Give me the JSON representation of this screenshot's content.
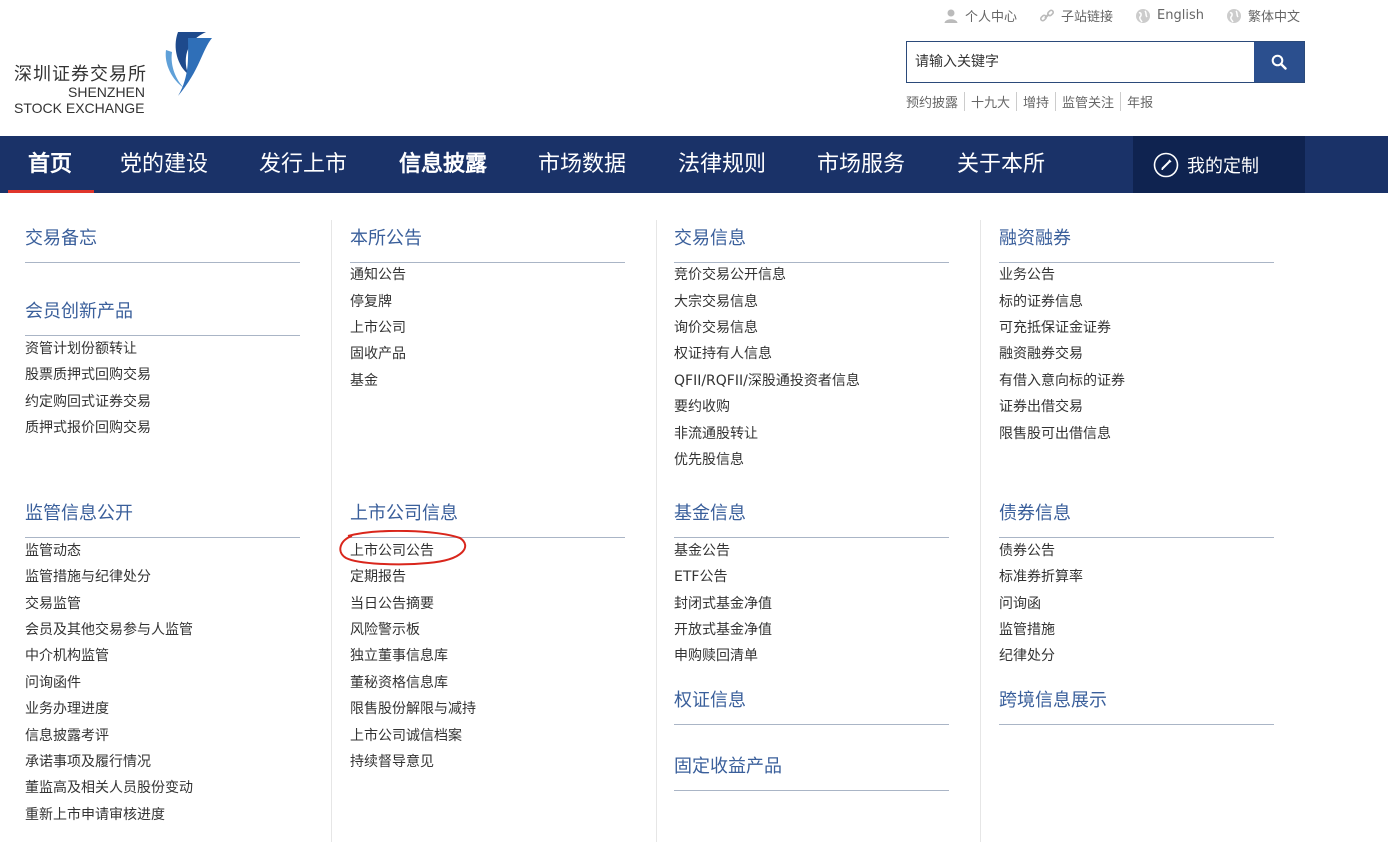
{
  "logo": {
    "cn": "深圳证券交易所",
    "en1": "SHENZHEN",
    "en2": "STOCK EXCHANGE"
  },
  "top_links": [
    "个人中心",
    "子站链接",
    "English",
    "繁体中文"
  ],
  "search": {
    "placeholder": "请输入关键字"
  },
  "hot_words": [
    "预约披露",
    "十九大",
    "增持",
    "监管关注",
    "年报"
  ],
  "nav": {
    "items": [
      "首页",
      "党的建设",
      "发行上市",
      "信息披露",
      "市场数据",
      "法律规则",
      "市场服务",
      "关于本所"
    ],
    "custom_label": "我的定制",
    "colors": {
      "bar": "#1a3268",
      "custom": "#0f2350",
      "active_underline": "#e0352b"
    }
  },
  "sections": {
    "trade_memo": {
      "title": "交易备忘"
    },
    "member_products": {
      "title": "会员创新产品",
      "links": [
        "资管计划份额转让",
        "股票质押式回购交易",
        "约定购回式证券交易",
        "质押式报价回购交易"
      ]
    },
    "supervision": {
      "title": "监管信息公开",
      "links": [
        "监管动态",
        "监管措施与纪律处分",
        "交易监管",
        "会员及其他交易参与人监管",
        "中介机构监管",
        "问询函件",
        "业务办理进度",
        "信息披露考评",
        "承诺事项及履行情况",
        "董监高及相关人员股份变动",
        "重新上市申请审核进度"
      ]
    },
    "exchange_notice": {
      "title": "本所公告",
      "links": [
        "通知公告",
        "停复牌",
        "上市公司",
        "固收产品",
        "基金"
      ]
    },
    "listed_company": {
      "title": "上市公司信息",
      "links": [
        "上市公司公告",
        "定期报告",
        "当日公告摘要",
        "风险警示板",
        "独立董事信息库",
        "董秘资格信息库",
        "限售股份解限与减持",
        "上市公司诚信档案",
        "持续督导意见"
      ]
    },
    "trade_info": {
      "title": "交易信息",
      "links": [
        "竞价交易公开信息",
        "大宗交易信息",
        "询价交易信息",
        "权证持有人信息",
        "QFII/RQFII/深股通投资者信息",
        "要约收购",
        "非流通股转让",
        "优先股信息"
      ]
    },
    "fund_info": {
      "title": "基金信息",
      "links": [
        "基金公告",
        "ETF公告",
        "封闭式基金净值",
        "开放式基金净值",
        "申购赎回清单"
      ]
    },
    "warrant_info": {
      "title": "权证信息"
    },
    "fixed_income": {
      "title": "固定收益产品"
    },
    "margin": {
      "title": "融资融券",
      "links": [
        "业务公告",
        "标的证券信息",
        "可充抵保证金证券",
        "融资融券交易",
        "有借入意向标的证券",
        "证券出借交易",
        "限售股可出借信息"
      ]
    },
    "bond_info": {
      "title": "债券信息",
      "links": [
        "债券公告",
        "标准券折算率",
        "问询函",
        "监管措施",
        "纪律处分"
      ]
    },
    "cross_border": {
      "title": "跨境信息展示"
    }
  },
  "highlight_color": "#d9261c",
  "icons": [
    "user-icon",
    "link-icon",
    "globe-icon",
    "globe-icon",
    "search-icon",
    "custom-icon"
  ]
}
